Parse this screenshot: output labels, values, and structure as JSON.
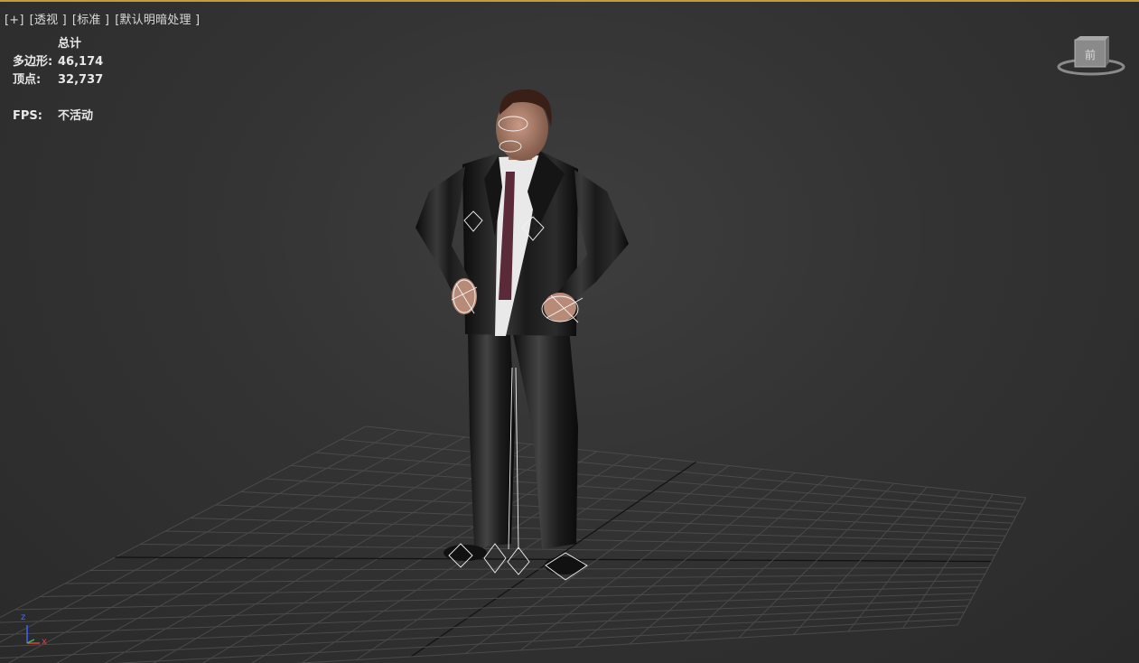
{
  "viewport": {
    "label_plus": "[+]",
    "label_view": "[透视 ]",
    "label_shading": "[标准 ]",
    "label_lighting": "[默认明暗处理 ]"
  },
  "stats": {
    "header": "总计",
    "polys_label": "多边形:",
    "polys_value": "46,174",
    "verts_label": "顶点:",
    "verts_value": "32,737",
    "fps_label": "FPS:",
    "fps_value": "不活动"
  },
  "viewcube": {
    "face_label": "前"
  },
  "axes": {
    "z": "z",
    "x": "x"
  },
  "colors": {
    "background": "#333333",
    "grid": "#4a4a4a",
    "grid_axis": "#111111",
    "active_border": "#c89a3a",
    "axis_x": "#e04040",
    "axis_y": "#40c040",
    "axis_z": "#4060ff"
  }
}
